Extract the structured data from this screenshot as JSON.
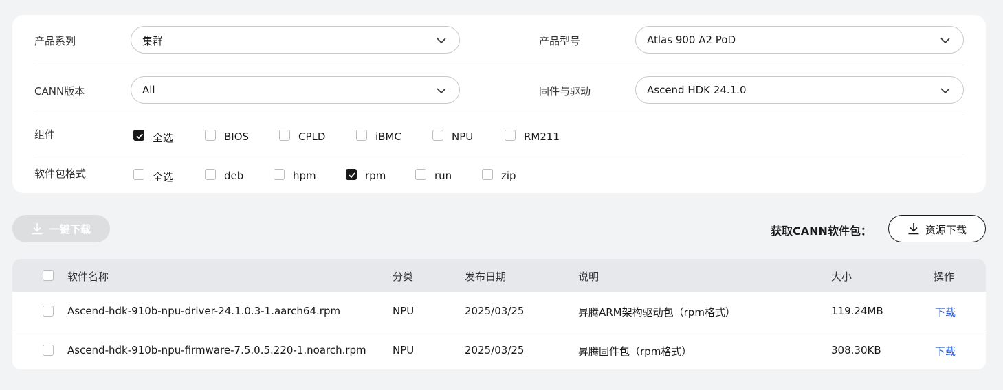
{
  "filters": {
    "series_label": "产品系列",
    "series_value": "集群",
    "model_label": "产品型号",
    "model_value": "Atlas 900 A2 PoD",
    "cann_label": "CANN版本",
    "cann_value": "All",
    "firmware_label": "固件与驱动",
    "firmware_value": "Ascend HDK 24.1.0",
    "components_label": "组件",
    "components": [
      {
        "label": "全选",
        "checked": true
      },
      {
        "label": "BIOS",
        "checked": false
      },
      {
        "label": "CPLD",
        "checked": false
      },
      {
        "label": "iBMC",
        "checked": false
      },
      {
        "label": "NPU",
        "checked": false
      },
      {
        "label": "RM211",
        "checked": false
      }
    ],
    "format_label": "软件包格式",
    "formats": [
      {
        "label": "全选",
        "checked": false
      },
      {
        "label": "deb",
        "checked": false
      },
      {
        "label": "hpm",
        "checked": false
      },
      {
        "label": "rpm",
        "checked": true
      },
      {
        "label": "run",
        "checked": false
      },
      {
        "label": "zip",
        "checked": false
      }
    ]
  },
  "toolbar": {
    "oneclick_label": "一键下载",
    "get_cann_label": "获取CANN软件包：",
    "resource_label": "资源下载"
  },
  "table": {
    "headers": {
      "name": "软件名称",
      "category": "分类",
      "date": "发布日期",
      "desc": "说明",
      "size": "大小",
      "action": "操作"
    },
    "rows": [
      {
        "name": "Ascend-hdk-910b-npu-driver-24.1.0.3-1.aarch64.rpm",
        "category": "NPU",
        "date": "2025/03/25",
        "desc": "昇腾ARM架构驱动包（rpm格式）",
        "size": "119.24MB",
        "action": "下载"
      },
      {
        "name": "Ascend-hdk-910b-npu-firmware-7.5.0.5.220-1.noarch.rpm",
        "category": "NPU",
        "date": "2025/03/25",
        "desc": "昇腾固件包（rpm格式）",
        "size": "308.30KB",
        "action": "下载"
      }
    ]
  },
  "colors": {
    "page_bg": "#f1f3f5",
    "link": "#2b5cd9",
    "checked": "#191919"
  }
}
